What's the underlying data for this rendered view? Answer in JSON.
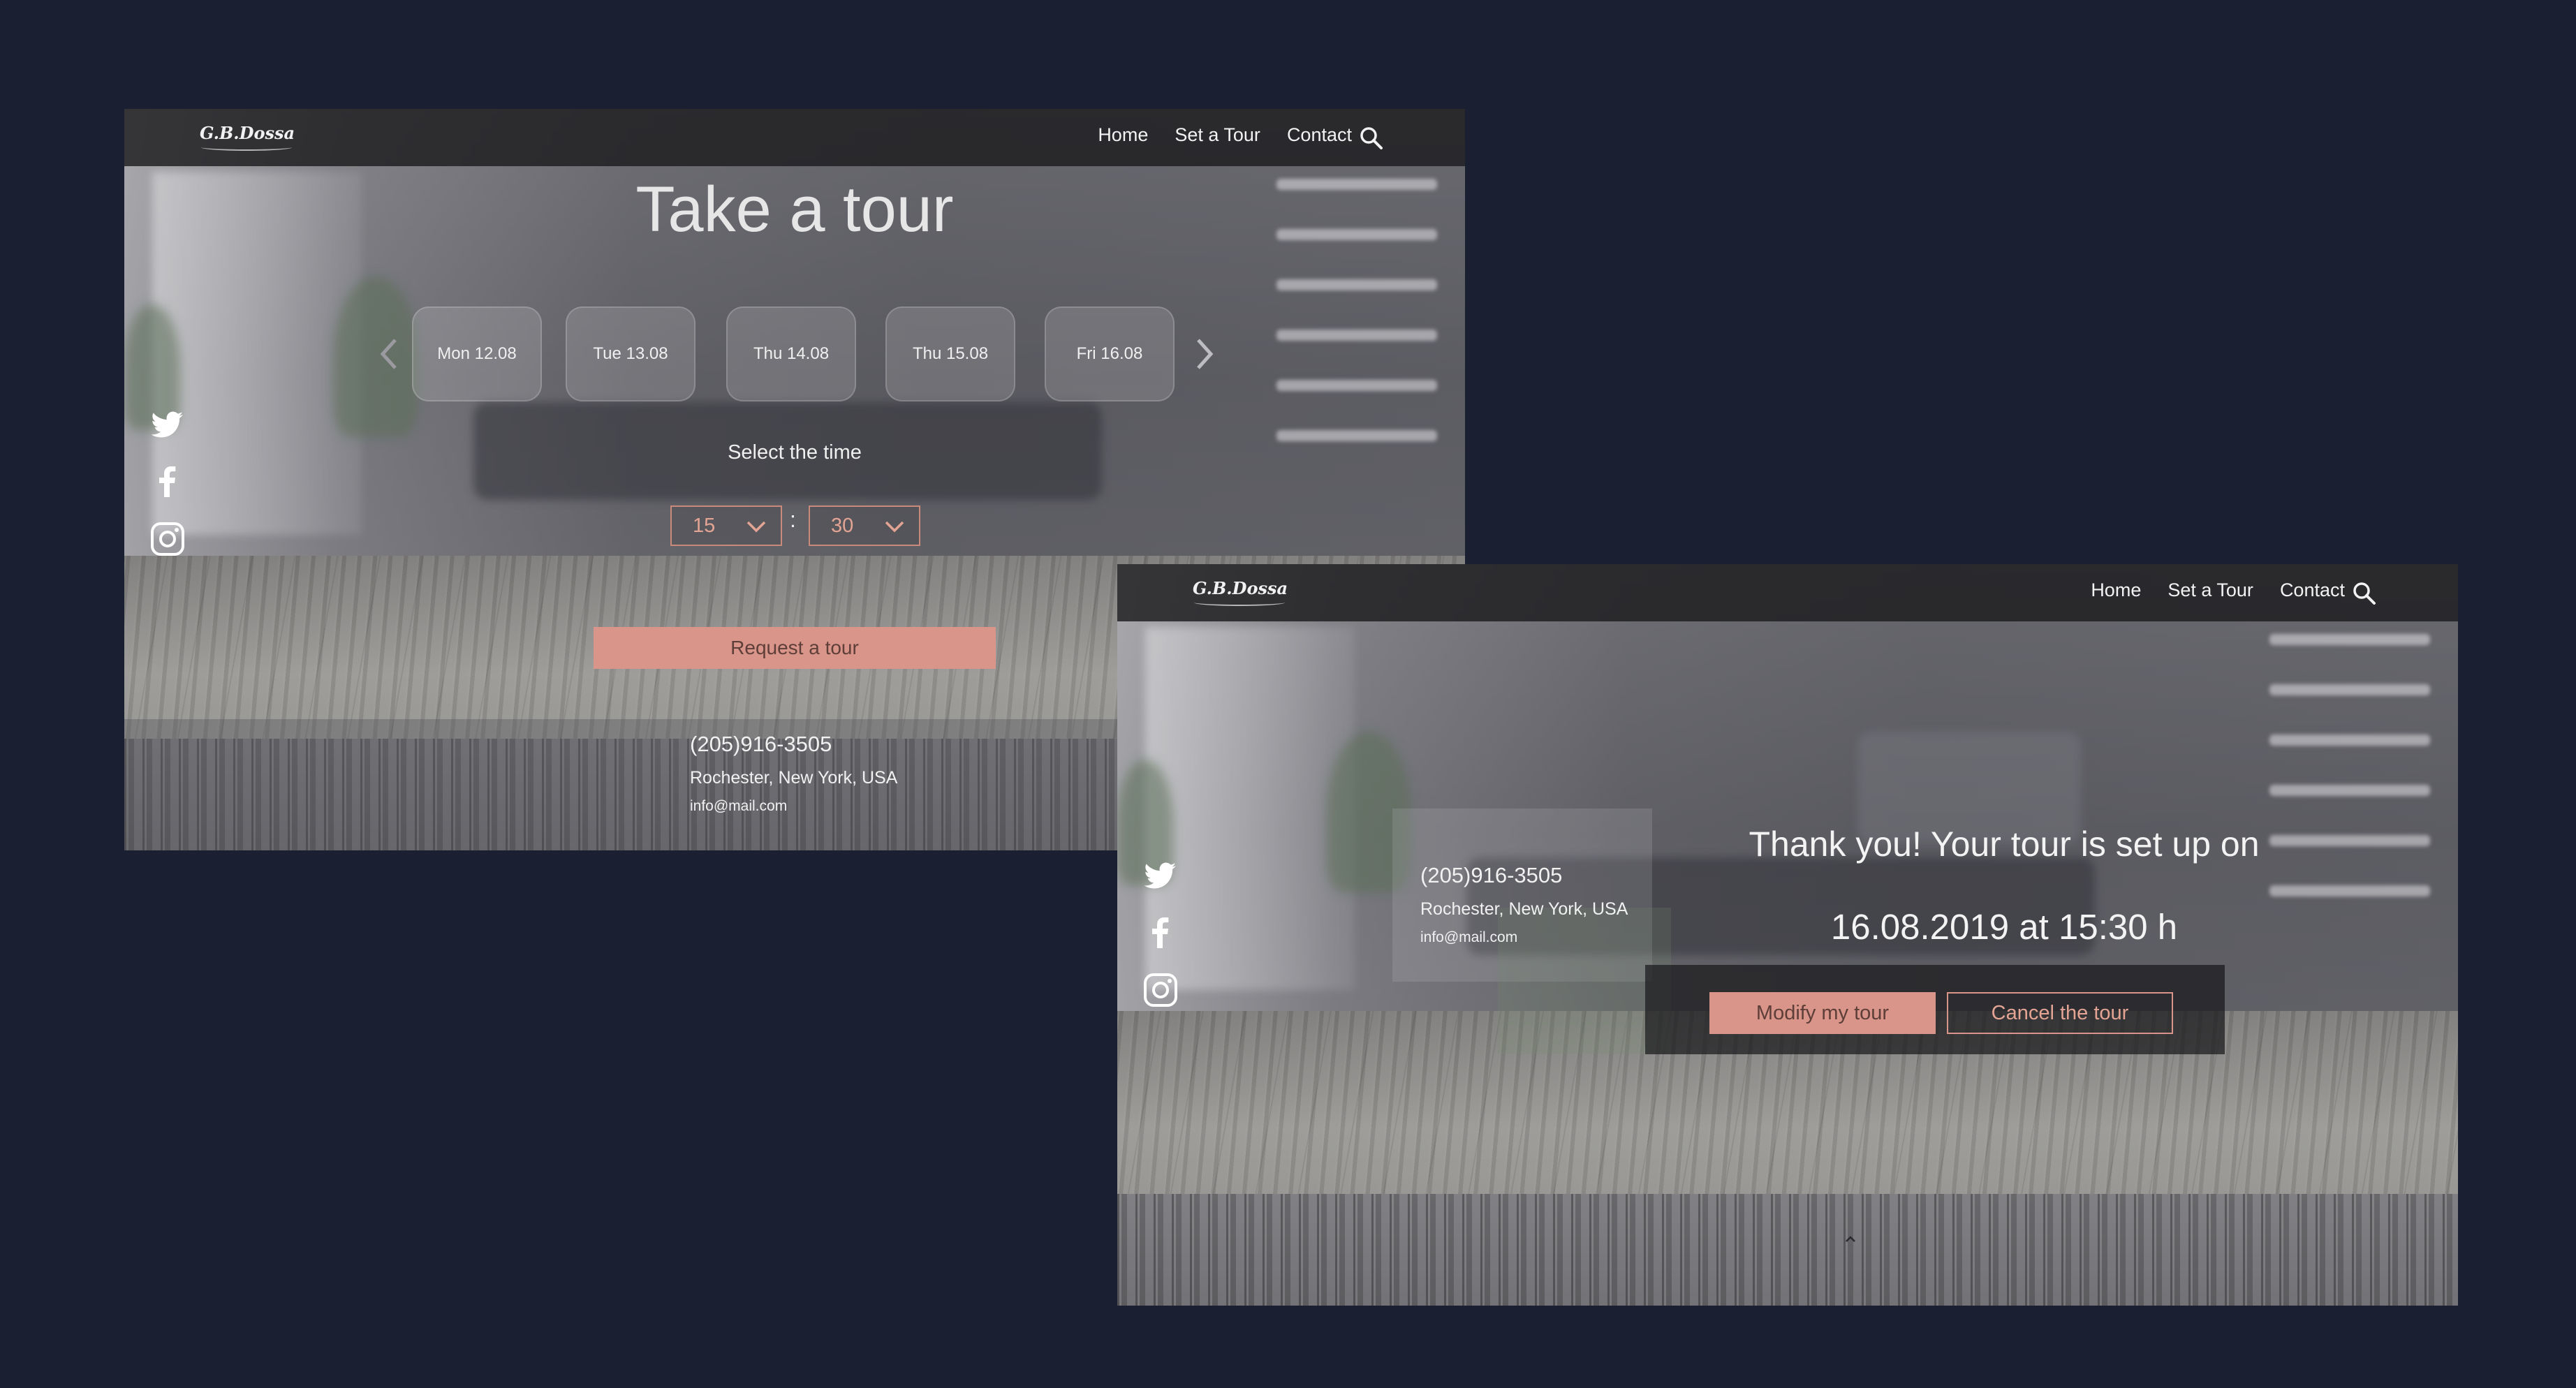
{
  "brand": {
    "logo_text": "G.B.Dossa"
  },
  "nav": {
    "items": [
      "Home",
      "Set a Tour",
      "Contact"
    ]
  },
  "social": [
    "twitter-icon",
    "facebook-icon",
    "instagram-icon"
  ],
  "tour_page": {
    "title": "Take a tour",
    "days": [
      "Mon 12.08",
      "Tue 13.08",
      "Thu 14.08",
      "Thu 15.08",
      "Fri 16.08"
    ],
    "select_time_label": "Select the time",
    "hour": "15",
    "minute": "30",
    "separator": ":",
    "request_button": "Request a tour"
  },
  "contact": {
    "phone": "(205)916-3505",
    "address": "Rochester, New York, USA",
    "email": "info@mail.com"
  },
  "confirmation_page": {
    "message": "Thank you! Your tour is set up on",
    "date_line": "16.08.2019 at 15:30 h",
    "modify_button": "Modify my tour",
    "cancel_button": "Cancel the tour"
  },
  "colors": {
    "page_bg": "#1a1f31",
    "accent": "#d9958a",
    "accent_text": "#e3a494"
  }
}
